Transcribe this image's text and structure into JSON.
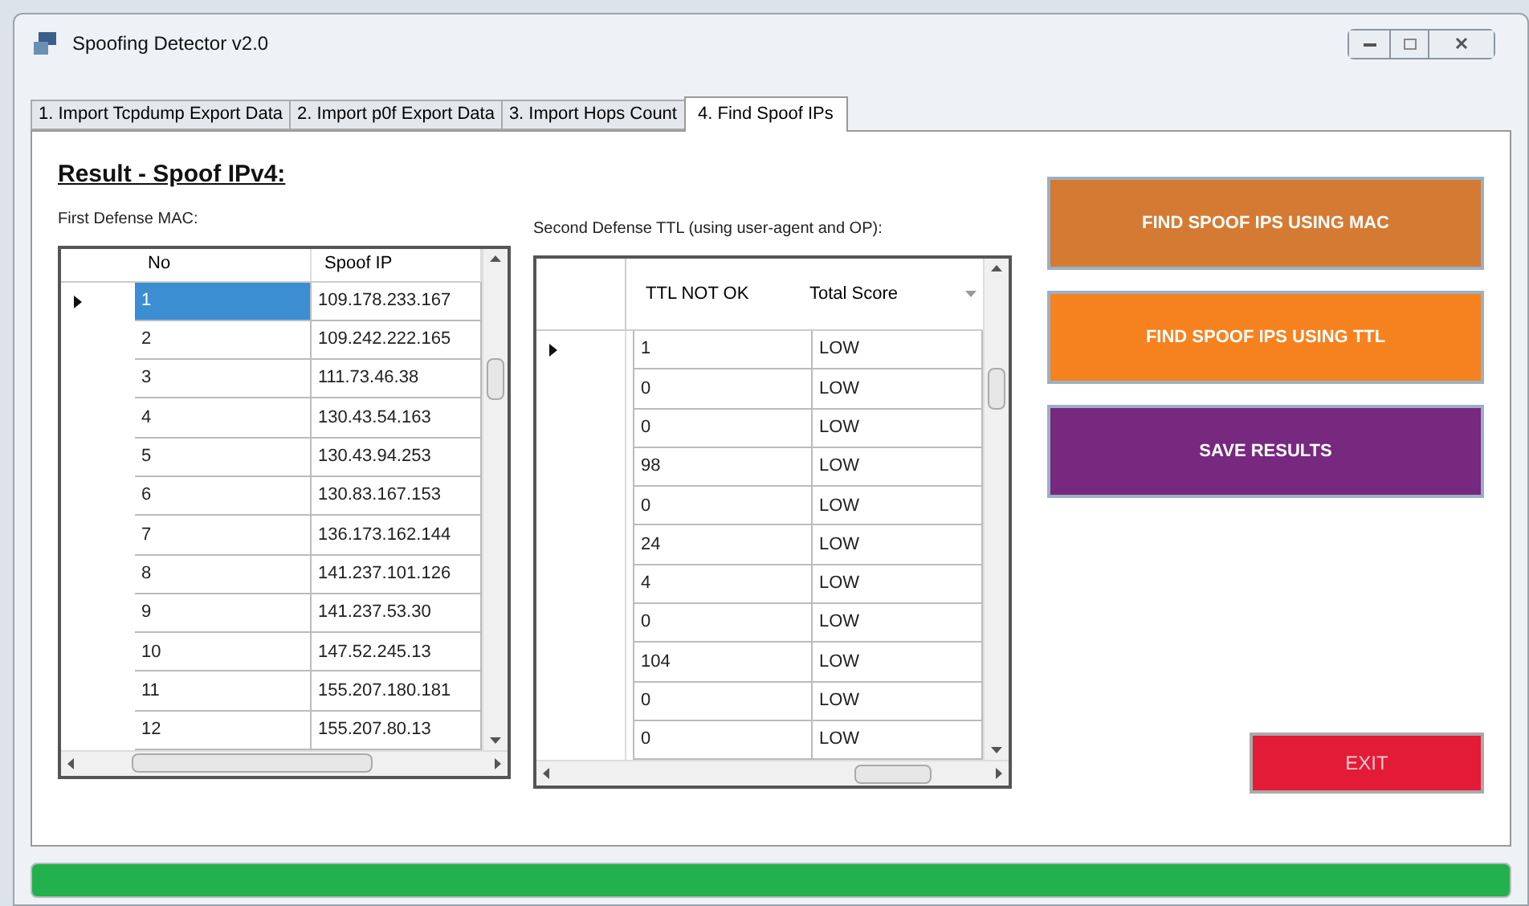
{
  "window": {
    "title": "Spoofing Detector v2.0"
  },
  "tabs": [
    {
      "label": "1. Import Tcpdump Export Data",
      "selected": false
    },
    {
      "label": "2. Import p0f Export Data",
      "selected": false
    },
    {
      "label": "3. Import Hops Count",
      "selected": false
    },
    {
      "label": "4. Find Spoof IPs",
      "selected": true
    }
  ],
  "heading": "Result - Spoof IPv4:",
  "mac_table": {
    "label": "First Defense MAC:",
    "columns": [
      "No",
      "Spoof IP"
    ],
    "rows": [
      {
        "cells": [
          "1",
          "109.178.233.167"
        ],
        "selected": true
      },
      {
        "cells": [
          "2",
          "109.242.222.165"
        ],
        "selected": false
      },
      {
        "cells": [
          "3",
          "111.73.46.38"
        ],
        "selected": false
      },
      {
        "cells": [
          "4",
          "130.43.54.163"
        ],
        "selected": false
      },
      {
        "cells": [
          "5",
          "130.43.94.253"
        ],
        "selected": false
      },
      {
        "cells": [
          "6",
          "130.83.167.153"
        ],
        "selected": false
      },
      {
        "cells": [
          "7",
          "136.173.162.144"
        ],
        "selected": false
      },
      {
        "cells": [
          "8",
          "141.237.101.126"
        ],
        "selected": false
      },
      {
        "cells": [
          "9",
          "141.237.53.30"
        ],
        "selected": false
      },
      {
        "cells": [
          "10",
          "147.52.245.13"
        ],
        "selected": false
      },
      {
        "cells": [
          "11",
          "155.207.180.181"
        ],
        "selected": false
      },
      {
        "cells": [
          "12",
          "155.207.80.13"
        ],
        "selected": false
      }
    ]
  },
  "ttl_table": {
    "label": "Second Defense TTL (using user-agent and OP):",
    "columns": [
      "TTL NOT OK",
      "Total Score"
    ],
    "rows": [
      {
        "cells": [
          "1",
          "LOW"
        ],
        "selected": true
      },
      {
        "cells": [
          "0",
          "LOW"
        ],
        "selected": false
      },
      {
        "cells": [
          "0",
          "LOW"
        ],
        "selected": false
      },
      {
        "cells": [
          "98",
          "LOW"
        ],
        "selected": false
      },
      {
        "cells": [
          "0",
          "LOW"
        ],
        "selected": false
      },
      {
        "cells": [
          "24",
          "LOW"
        ],
        "selected": false
      },
      {
        "cells": [
          "4",
          "LOW"
        ],
        "selected": false
      },
      {
        "cells": [
          "0",
          "LOW"
        ],
        "selected": false
      },
      {
        "cells": [
          "104",
          "LOW"
        ],
        "selected": false
      },
      {
        "cells": [
          "0",
          "LOW"
        ],
        "selected": false
      },
      {
        "cells": [
          "0",
          "LOW"
        ],
        "selected": false
      }
    ]
  },
  "actions": [
    {
      "label": "FIND SPOOF IPS USING MAC",
      "color": "#d57a33"
    },
    {
      "label": "FIND SPOOF IPS USING TTL",
      "color": "#f5821f"
    },
    {
      "label": "SAVE RESULTS",
      "color": "#77287f"
    }
  ],
  "exit_button": {
    "label": "EXIT",
    "color": "#e31b37"
  },
  "progress": {
    "level": 1
  }
}
